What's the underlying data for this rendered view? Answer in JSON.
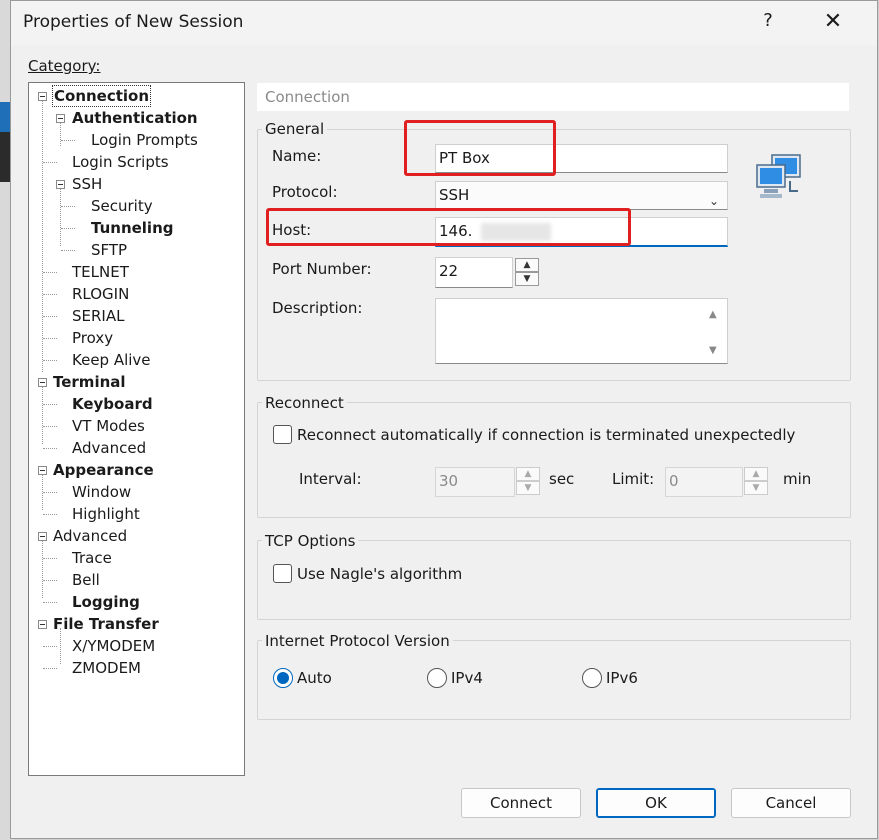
{
  "window": {
    "title": "Properties of New Session",
    "help_label": "?",
    "close_label": "✕"
  },
  "category_label": "Category:",
  "tree": [
    {
      "label": "Connection",
      "bold": true,
      "selected": true
    },
    {
      "label": "Authentication",
      "bold": true
    },
    {
      "label": "Login Prompts"
    },
    {
      "label": "Login Scripts"
    },
    {
      "label": "SSH"
    },
    {
      "label": "Security"
    },
    {
      "label": "Tunneling",
      "bold": true
    },
    {
      "label": "SFTP"
    },
    {
      "label": "TELNET"
    },
    {
      "label": "RLOGIN"
    },
    {
      "label": "SERIAL"
    },
    {
      "label": "Proxy"
    },
    {
      "label": "Keep Alive"
    },
    {
      "label": "Terminal",
      "bold": true
    },
    {
      "label": "Keyboard",
      "bold": true
    },
    {
      "label": "VT Modes"
    },
    {
      "label": "Advanced"
    },
    {
      "label": "Appearance",
      "bold": true
    },
    {
      "label": "Window"
    },
    {
      "label": "Highlight"
    },
    {
      "label": "Advanced"
    },
    {
      "label": "Trace"
    },
    {
      "label": "Bell"
    },
    {
      "label": "Logging",
      "bold": true
    },
    {
      "label": "File Transfer",
      "bold": true
    },
    {
      "label": "X/YMODEM"
    },
    {
      "label": "ZMODEM"
    }
  ],
  "section_header": "Connection",
  "general": {
    "group_label": "General",
    "name_label": "Name:",
    "name_value": "PT Box",
    "protocol_label": "Protocol:",
    "protocol_value": "SSH",
    "host_label": "Host:",
    "host_value": "146.",
    "port_label": "Port Number:",
    "port_value": "22",
    "description_label": "Description:",
    "icon": "network-computer-icon"
  },
  "reconnect": {
    "group_label": "Reconnect",
    "checkbox_label": "Reconnect automatically if connection is terminated unexpectedly",
    "checked": false,
    "interval_label": "Interval:",
    "interval_value": "30",
    "interval_unit": "sec",
    "limit_label": "Limit:",
    "limit_value": "0",
    "limit_unit": "min"
  },
  "tcp": {
    "group_label": "TCP Options",
    "nagle_label": "Use Nagle's algorithm",
    "checked": false
  },
  "ip_version": {
    "group_label": "Internet Protocol Version",
    "options": [
      "Auto",
      "IPv4",
      "IPv6"
    ],
    "selected": "Auto"
  },
  "buttons": {
    "connect": "Connect",
    "ok": "OK",
    "cancel": "Cancel"
  },
  "colors": {
    "accent": "#0067c0",
    "highlight_box": "#e02020"
  }
}
